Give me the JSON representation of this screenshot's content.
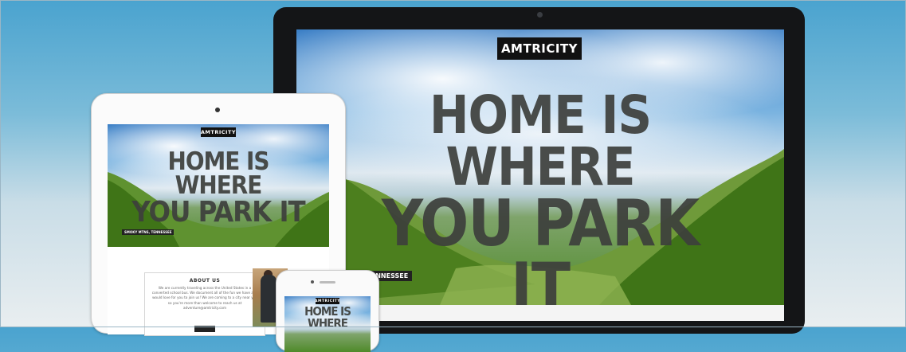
{
  "desktop": {
    "brand": "AMTRICITY",
    "headline_line1": "HOME IS WHERE",
    "headline_line2": "YOU PARK IT",
    "location": "E, TENNESSEE"
  },
  "tablet": {
    "brand": "AMTRICITY",
    "headline_line1": "HOME IS WHERE",
    "headline_line2": "YOU PARK IT",
    "location": "SMOKY MTNS, TENNESSEE",
    "about_title": "ABOUT US",
    "about_text": "We are currently traveling across the United States in a converted school bus. We document all of the fun we have and would love for you to join us! We are coming to a city near you so you're more than welcome to reach us at adventure@amtricity.com"
  },
  "phone": {
    "brand": "AMTRICITY",
    "headline_line1": "HOME IS WHERE"
  },
  "colors": {
    "background_top": "#4aa3cf",
    "background_bottom": "#e9eef0",
    "brand_bg": "#111111",
    "headline": "#3d3f3c"
  }
}
